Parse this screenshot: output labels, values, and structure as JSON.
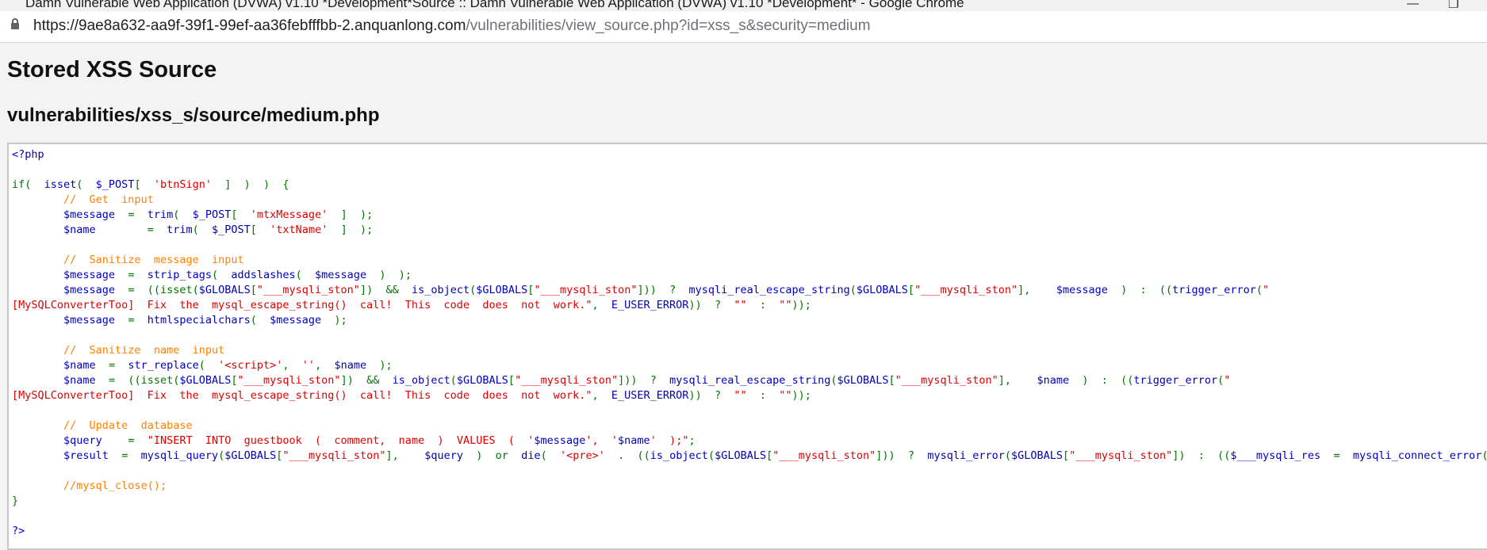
{
  "window": {
    "title": "Damn Vulnerable Web Application (DVWA) v1.10 *Development*Source :: Damn Vulnerable Web Application (DVWA) v1.10 *Development* - Google Chrome"
  },
  "address_bar": {
    "url_host": "https://9ae8a632-aa9f-39f1-99ef-aa36febfffbb-2.anquanlong.com",
    "url_path": "/vulnerabilities/view_source.php?id=xss_s&security=medium"
  },
  "page": {
    "title": "Stored XSS Source",
    "file_path": "vulnerabilities/xss_s/source/medium.php"
  },
  "code_lines": [
    [
      {
        "c": "blue",
        "t": "<?php"
      }
    ],
    [],
    [
      {
        "c": "green",
        "t": "if(  "
      },
      {
        "c": "blue",
        "t": "isset"
      },
      {
        "c": "green",
        "t": "(  "
      },
      {
        "c": "blue",
        "t": "$_POST"
      },
      {
        "c": "green",
        "t": "[  "
      },
      {
        "c": "red",
        "t": "'btnSign'"
      },
      {
        "c": "green",
        "t": "  ]  )  )  {"
      }
    ],
    [
      {
        "c": "green",
        "t": "        "
      },
      {
        "c": "orange",
        "t": "//  Get  input"
      }
    ],
    [
      {
        "c": "green",
        "t": "        "
      },
      {
        "c": "blue",
        "t": "$message  "
      },
      {
        "c": "green",
        "t": "=  "
      },
      {
        "c": "blue",
        "t": "trim"
      },
      {
        "c": "green",
        "t": "(  "
      },
      {
        "c": "blue",
        "t": "$_POST"
      },
      {
        "c": "green",
        "t": "[  "
      },
      {
        "c": "red",
        "t": "'mtxMessage'"
      },
      {
        "c": "green",
        "t": "  ]  );"
      }
    ],
    [
      {
        "c": "green",
        "t": "        "
      },
      {
        "c": "blue",
        "t": "$name        "
      },
      {
        "c": "green",
        "t": "=  "
      },
      {
        "c": "blue",
        "t": "trim"
      },
      {
        "c": "green",
        "t": "(  "
      },
      {
        "c": "blue",
        "t": "$_POST"
      },
      {
        "c": "green",
        "t": "[  "
      },
      {
        "c": "red",
        "t": "'txtName'"
      },
      {
        "c": "green",
        "t": "  ]  );"
      }
    ],
    [],
    [
      {
        "c": "green",
        "t": "        "
      },
      {
        "c": "orange",
        "t": "//  Sanitize  message  input"
      }
    ],
    [
      {
        "c": "green",
        "t": "        "
      },
      {
        "c": "blue",
        "t": "$message  "
      },
      {
        "c": "green",
        "t": "=  "
      },
      {
        "c": "blue",
        "t": "strip_tags"
      },
      {
        "c": "green",
        "t": "(  "
      },
      {
        "c": "blue",
        "t": "addslashes"
      },
      {
        "c": "green",
        "t": "(  "
      },
      {
        "c": "blue",
        "t": "$message  "
      },
      {
        "c": "green",
        "t": ")  );"
      }
    ],
    [
      {
        "c": "green",
        "t": "        "
      },
      {
        "c": "blue",
        "t": "$message  "
      },
      {
        "c": "green",
        "t": "=  ((isset("
      },
      {
        "c": "blue",
        "t": "$GLOBALS"
      },
      {
        "c": "green",
        "t": "["
      },
      {
        "c": "red",
        "t": "\"___mysqli_ston\""
      },
      {
        "c": "green",
        "t": "])  &&  "
      },
      {
        "c": "blue",
        "t": "is_object"
      },
      {
        "c": "green",
        "t": "("
      },
      {
        "c": "blue",
        "t": "$GLOBALS"
      },
      {
        "c": "green",
        "t": "["
      },
      {
        "c": "red",
        "t": "\"___mysqli_ston\""
      },
      {
        "c": "green",
        "t": "]))  ?  "
      },
      {
        "c": "blue",
        "t": "mysqli_real_escape_string"
      },
      {
        "c": "green",
        "t": "("
      },
      {
        "c": "blue",
        "t": "$GLOBALS"
      },
      {
        "c": "green",
        "t": "["
      },
      {
        "c": "red",
        "t": "\"___mysqli_ston\""
      },
      {
        "c": "green",
        "t": "],    "
      },
      {
        "c": "blue",
        "t": "$message  "
      },
      {
        "c": "green",
        "t": ")  :  (("
      },
      {
        "c": "blue",
        "t": "trigger_error"
      },
      {
        "c": "green",
        "t": "("
      },
      {
        "c": "red",
        "t": "\""
      }
    ],
    [
      {
        "c": "red",
        "t": "[MySQLConverterToo]  Fix  the  mysql_escape_string()  call!  This  code  does  not  work.\""
      },
      {
        "c": "green",
        "t": ",  "
      },
      {
        "c": "blue",
        "t": "E_USER_ERROR"
      },
      {
        "c": "green",
        "t": "))  ?  "
      },
      {
        "c": "red",
        "t": "\"\""
      },
      {
        "c": "green",
        "t": "  :  "
      },
      {
        "c": "red",
        "t": "\"\""
      },
      {
        "c": "green",
        "t": "));"
      }
    ],
    [
      {
        "c": "green",
        "t": "        "
      },
      {
        "c": "blue",
        "t": "$message  "
      },
      {
        "c": "green",
        "t": "=  "
      },
      {
        "c": "blue",
        "t": "htmlspecialchars"
      },
      {
        "c": "green",
        "t": "(  "
      },
      {
        "c": "blue",
        "t": "$message  "
      },
      {
        "c": "green",
        "t": ");"
      }
    ],
    [],
    [
      {
        "c": "green",
        "t": "        "
      },
      {
        "c": "orange",
        "t": "//  Sanitize  name  input"
      }
    ],
    [
      {
        "c": "green",
        "t": "        "
      },
      {
        "c": "blue",
        "t": "$name  "
      },
      {
        "c": "green",
        "t": "=  "
      },
      {
        "c": "blue",
        "t": "str_replace"
      },
      {
        "c": "green",
        "t": "(  "
      },
      {
        "c": "red",
        "t": "'<script>'"
      },
      {
        "c": "green",
        "t": ",  "
      },
      {
        "c": "red",
        "t": "''"
      },
      {
        "c": "green",
        "t": ",  "
      },
      {
        "c": "blue",
        "t": "$name  "
      },
      {
        "c": "green",
        "t": ");"
      }
    ],
    [
      {
        "c": "green",
        "t": "        "
      },
      {
        "c": "blue",
        "t": "$name  "
      },
      {
        "c": "green",
        "t": "=  ((isset("
      },
      {
        "c": "blue",
        "t": "$GLOBALS"
      },
      {
        "c": "green",
        "t": "["
      },
      {
        "c": "red",
        "t": "\"___mysqli_ston\""
      },
      {
        "c": "green",
        "t": "])  &&  "
      },
      {
        "c": "blue",
        "t": "is_object"
      },
      {
        "c": "green",
        "t": "("
      },
      {
        "c": "blue",
        "t": "$GLOBALS"
      },
      {
        "c": "green",
        "t": "["
      },
      {
        "c": "red",
        "t": "\"___mysqli_ston\""
      },
      {
        "c": "green",
        "t": "]))  ?  "
      },
      {
        "c": "blue",
        "t": "mysqli_real_escape_string"
      },
      {
        "c": "green",
        "t": "("
      },
      {
        "c": "blue",
        "t": "$GLOBALS"
      },
      {
        "c": "green",
        "t": "["
      },
      {
        "c": "red",
        "t": "\"___mysqli_ston\""
      },
      {
        "c": "green",
        "t": "],    "
      },
      {
        "c": "blue",
        "t": "$name  "
      },
      {
        "c": "green",
        "t": ")  :  (("
      },
      {
        "c": "blue",
        "t": "trigger_error"
      },
      {
        "c": "green",
        "t": "("
      },
      {
        "c": "red",
        "t": "\""
      }
    ],
    [
      {
        "c": "red",
        "t": "[MySQLConverterToo]  Fix  the  mysql_escape_string()  call!  This  code  does  not  work.\""
      },
      {
        "c": "green",
        "t": ",  "
      },
      {
        "c": "blue",
        "t": "E_USER_ERROR"
      },
      {
        "c": "green",
        "t": "))  ?  "
      },
      {
        "c": "red",
        "t": "\"\""
      },
      {
        "c": "green",
        "t": "  :  "
      },
      {
        "c": "red",
        "t": "\"\""
      },
      {
        "c": "green",
        "t": "));"
      }
    ],
    [],
    [
      {
        "c": "green",
        "t": "        "
      },
      {
        "c": "orange",
        "t": "//  Update  database"
      }
    ],
    [
      {
        "c": "green",
        "t": "        "
      },
      {
        "c": "blue",
        "t": "$query    "
      },
      {
        "c": "green",
        "t": "=  "
      },
      {
        "c": "red",
        "t": "\"INSERT  INTO  guestbook  (  comment,  name  )  VALUES  (  '"
      },
      {
        "c": "blue",
        "t": "$message"
      },
      {
        "c": "red",
        "t": "',  '"
      },
      {
        "c": "blue",
        "t": "$name"
      },
      {
        "c": "red",
        "t": "'  );\""
      },
      {
        "c": "green",
        "t": ";"
      }
    ],
    [
      {
        "c": "green",
        "t": "        "
      },
      {
        "c": "blue",
        "t": "$result  "
      },
      {
        "c": "green",
        "t": "=  "
      },
      {
        "c": "blue",
        "t": "mysqli_query"
      },
      {
        "c": "green",
        "t": "("
      },
      {
        "c": "blue",
        "t": "$GLOBALS"
      },
      {
        "c": "green",
        "t": "["
      },
      {
        "c": "red",
        "t": "\"___mysqli_ston\""
      },
      {
        "c": "green",
        "t": "],    "
      },
      {
        "c": "blue",
        "t": "$query  "
      },
      {
        "c": "green",
        "t": ")  or  "
      },
      {
        "c": "blue",
        "t": "die"
      },
      {
        "c": "green",
        "t": "(  "
      },
      {
        "c": "red",
        "t": "'<pre>'  "
      },
      {
        "c": "green",
        "t": ".  (("
      },
      {
        "c": "blue",
        "t": "is_object"
      },
      {
        "c": "green",
        "t": "("
      },
      {
        "c": "blue",
        "t": "$GLOBALS"
      },
      {
        "c": "green",
        "t": "["
      },
      {
        "c": "red",
        "t": "\"___mysqli_ston\""
      },
      {
        "c": "green",
        "t": "]))  ?  "
      },
      {
        "c": "blue",
        "t": "mysqli_error"
      },
      {
        "c": "green",
        "t": "("
      },
      {
        "c": "blue",
        "t": "$GLOBALS"
      },
      {
        "c": "green",
        "t": "["
      },
      {
        "c": "red",
        "t": "\"___mysqli_ston\""
      },
      {
        "c": "green",
        "t": "])  :  (("
      },
      {
        "c": "blue",
        "t": "$___mysqli_res  "
      },
      {
        "c": "green",
        "t": "=  "
      },
      {
        "c": "blue",
        "t": "mysqli_connect_error"
      },
      {
        "c": "green",
        "t": "("
      }
    ],
    [],
    [
      {
        "c": "green",
        "t": "        "
      },
      {
        "c": "orange",
        "t": "//mysql_close();"
      }
    ],
    [
      {
        "c": "green",
        "t": "}"
      }
    ],
    [],
    [
      {
        "c": "blue",
        "t": "?>"
      }
    ]
  ]
}
